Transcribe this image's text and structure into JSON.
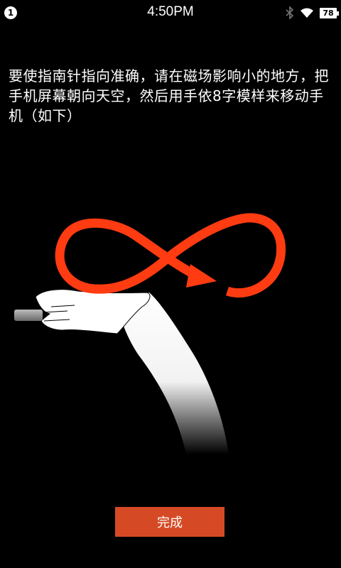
{
  "status_bar": {
    "notification_count": "1",
    "time": "4:50PM",
    "battery_level": "78",
    "icons": [
      "bluetooth-icon",
      "wifi-icon",
      "battery-icon"
    ]
  },
  "instruction": {
    "text": "要使指南针指向准确，请在磁场影响小的地方，把手机屏幕朝向天空，然后用手依8字模样来移动手机（如下）"
  },
  "illustration": {
    "icons": [
      "figure-eight-arrow-icon",
      "hand-holding-phone-icon"
    ],
    "accent_color": "#ff3b12"
  },
  "done_button": {
    "label": "完成",
    "color": "#d54a25"
  }
}
